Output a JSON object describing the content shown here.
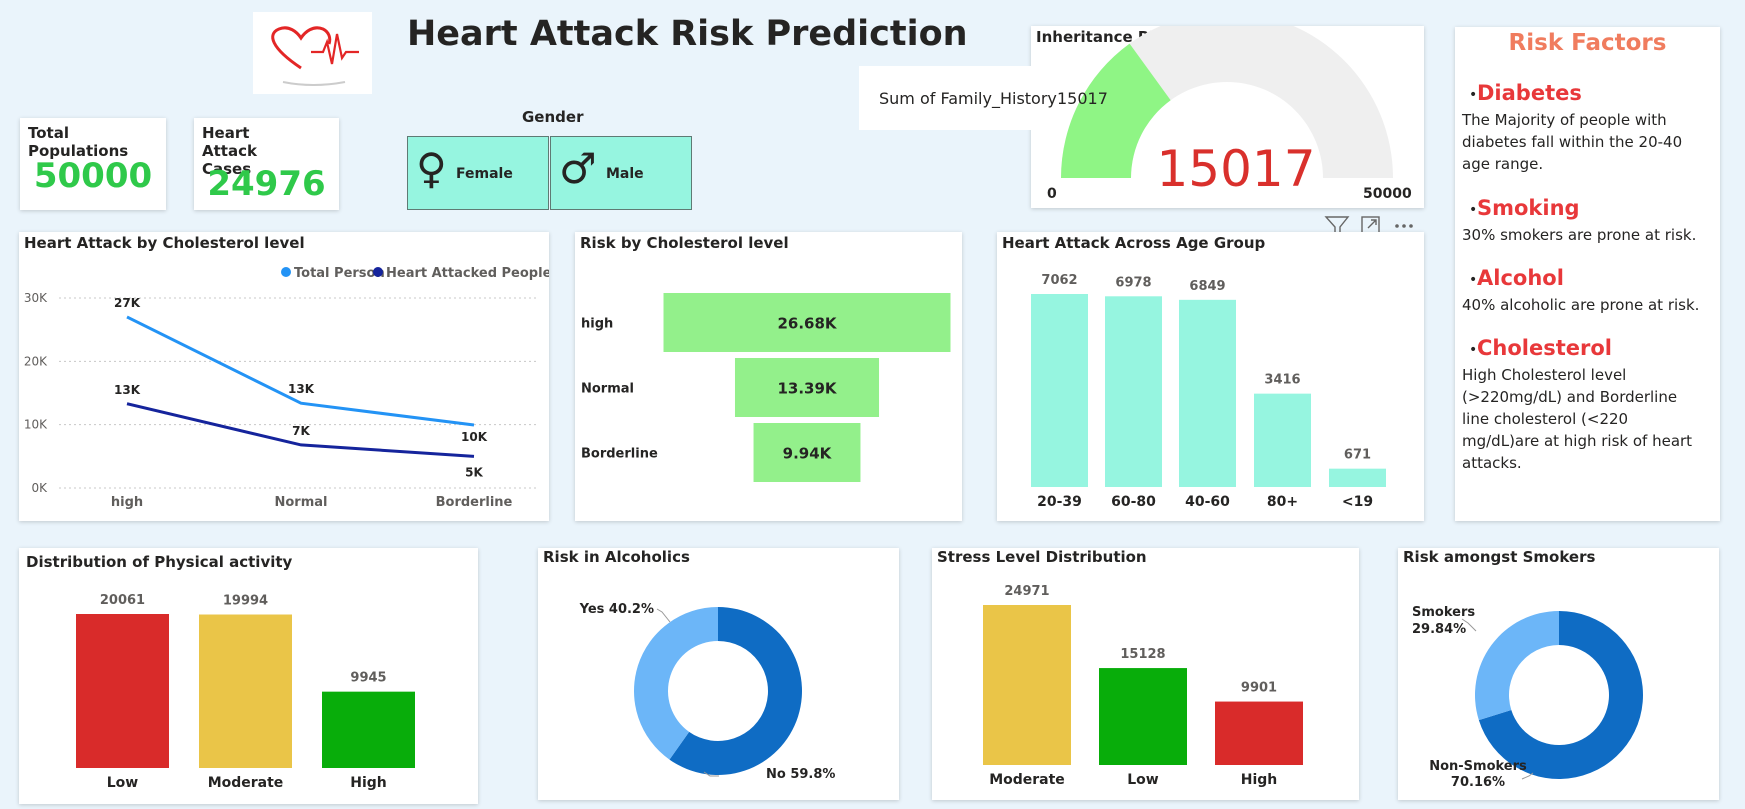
{
  "header": {
    "title": "Heart Attack Risk Prediction",
    "logo_icon": "heart-ecg-icon"
  },
  "kpis": {
    "total_populations": {
      "label": "Total Populations",
      "value": "50000"
    },
    "heart_attack_cases": {
      "label": "Heart Attack Cases",
      "value": "24976"
    }
  },
  "gender": {
    "title": "Gender",
    "buttons": [
      {
        "label": "Female",
        "icon": "female-symbol-icon"
      },
      {
        "label": "Male",
        "icon": "male-symbol-icon"
      }
    ]
  },
  "inheritance": {
    "title": "Inheritance Risk",
    "tooltip_label": "Sum of Family_History",
    "tooltip_value": "15017",
    "value_label": "15017",
    "min_label": "0",
    "max_label": "50000",
    "visual_header_icons": [
      "filter-icon",
      "focus-mode-icon",
      "more-options-icon"
    ]
  },
  "risk_factors": {
    "title": "Risk Factors",
    "items": [
      {
        "heading": "Diabetes",
        "text": "The Majority of people with diabetes fall  within the 20-40 age range."
      },
      {
        "heading": "Smoking",
        "text": "30% smokers are prone at risk."
      },
      {
        "heading": "Alcohol",
        "text": "40% alcoholic are prone at risk."
      },
      {
        "heading": "Cholesterol",
        "text": "High Cholesterol level (>220mg/dL) and  Borderline line cholesterol (<220 mg/dL)are at high risk of heart attacks."
      }
    ]
  },
  "colors": {
    "kpi_green": "#2fc94a",
    "gauge_fill": "#8ff585",
    "gauge_track": "#efefef",
    "gauge_value": "#d9302c",
    "mint": "#96f5e0",
    "funnel_green": "#93f08b",
    "line_total": "#2393f5",
    "line_attacked": "#15249c",
    "red": "#d92b2a",
    "yellow": "#eac548",
    "green": "#08ad0a",
    "donut_dark": "#0f6cc4",
    "donut_light": "#6cb6f8",
    "accent_heading": "#e8383a",
    "title_orange": "#f07c5e"
  },
  "chart_data": [
    {
      "id": "cholesterol_line",
      "type": "line",
      "title": "Heart Attack by Cholesterol level",
      "categories": [
        "high",
        "Normal",
        "Borderline"
      ],
      "series": [
        {
          "name": "Total Person",
          "values": [
            27,
            13.39,
            9.94
          ],
          "labels": [
            "27K",
            "13K",
            "10K"
          ]
        },
        {
          "name": "Heart Attacked People",
          "values": [
            13.3,
            6.8,
            5.0
          ],
          "labels": [
            "13K",
            "7K",
            "5K"
          ]
        }
      ],
      "ylim": [
        0,
        30
      ],
      "yticks": [
        "0K",
        "10K",
        "20K",
        "30K"
      ],
      "grid": true,
      "legend": "top-right"
    },
    {
      "id": "cholesterol_funnel",
      "type": "bar",
      "title": "Risk by Cholesterol level",
      "categories": [
        "high",
        "Normal",
        "Borderline"
      ],
      "values": [
        26.68,
        13.39,
        9.94
      ],
      "labels": [
        "26.68K",
        "13.39K",
        "9.94K"
      ]
    },
    {
      "id": "age_group",
      "type": "bar",
      "title": "Heart Attack Across Age Group",
      "categories": [
        "20-39",
        "60-80",
        "40-60",
        "80+",
        "<19"
      ],
      "values": [
        7062,
        6978,
        6849,
        3416,
        671
      ]
    },
    {
      "id": "physical_activity",
      "type": "bar",
      "title": "Distribution of Physical activity",
      "categories": [
        "Low",
        "Moderate",
        "High"
      ],
      "values": [
        20061,
        19994,
        9945
      ]
    },
    {
      "id": "alcoholics",
      "type": "pie",
      "title": "Risk in Alcoholics",
      "categories": [
        "No",
        "Yes"
      ],
      "values": [
        59.8,
        40.2
      ],
      "labels": [
        "No 59.8%",
        "Yes 40.2%"
      ]
    },
    {
      "id": "stress",
      "type": "bar",
      "title": "Stress Level Distribution",
      "categories": [
        "Moderate",
        "Low",
        "High"
      ],
      "values": [
        24971,
        15128,
        9901
      ]
    },
    {
      "id": "smokers",
      "type": "pie",
      "title": "Risk amongst Smokers",
      "categories": [
        "Non-Smokers",
        "Smokers"
      ],
      "values": [
        70.16,
        29.84
      ],
      "labels": [
        "Non-Smokers",
        "70.16%",
        "Smokers",
        "29.84%"
      ]
    },
    {
      "id": "inheritance_gauge",
      "type": "bar",
      "title": "Inheritance Risk",
      "categories": [
        "Sum of Family_History"
      ],
      "values": [
        15017
      ],
      "ylim": [
        0,
        50000
      ]
    }
  ]
}
